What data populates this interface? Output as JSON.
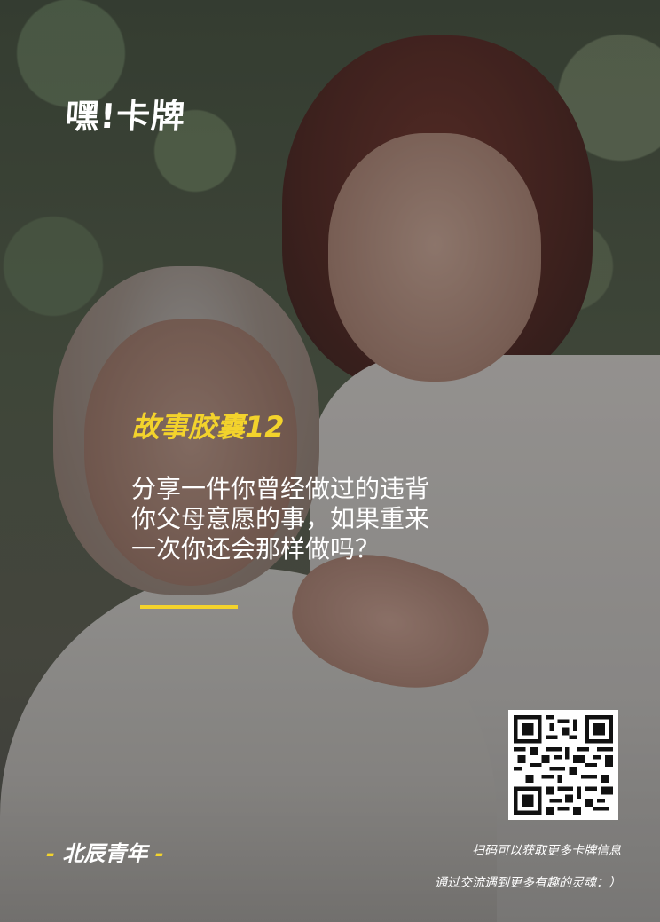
{
  "logo": {
    "text": "嘿!卡牌"
  },
  "card": {
    "title": "故事胶囊12",
    "question_lines": [
      "分享一件你曾经做过的违背",
      "你父母意愿的事，如果重来",
      "一次你还会那样做吗？"
    ]
  },
  "footer": {
    "brand_dash_left": "-",
    "brand": "北辰青年",
    "brand_dash_right": "-",
    "scan_note": "扫码可以获取更多卡牌信息",
    "exchange_note": "通过交流遇到更多有趣的灵魂：）"
  },
  "colors": {
    "accent": "#f3d32c",
    "text": "#ffffff"
  }
}
